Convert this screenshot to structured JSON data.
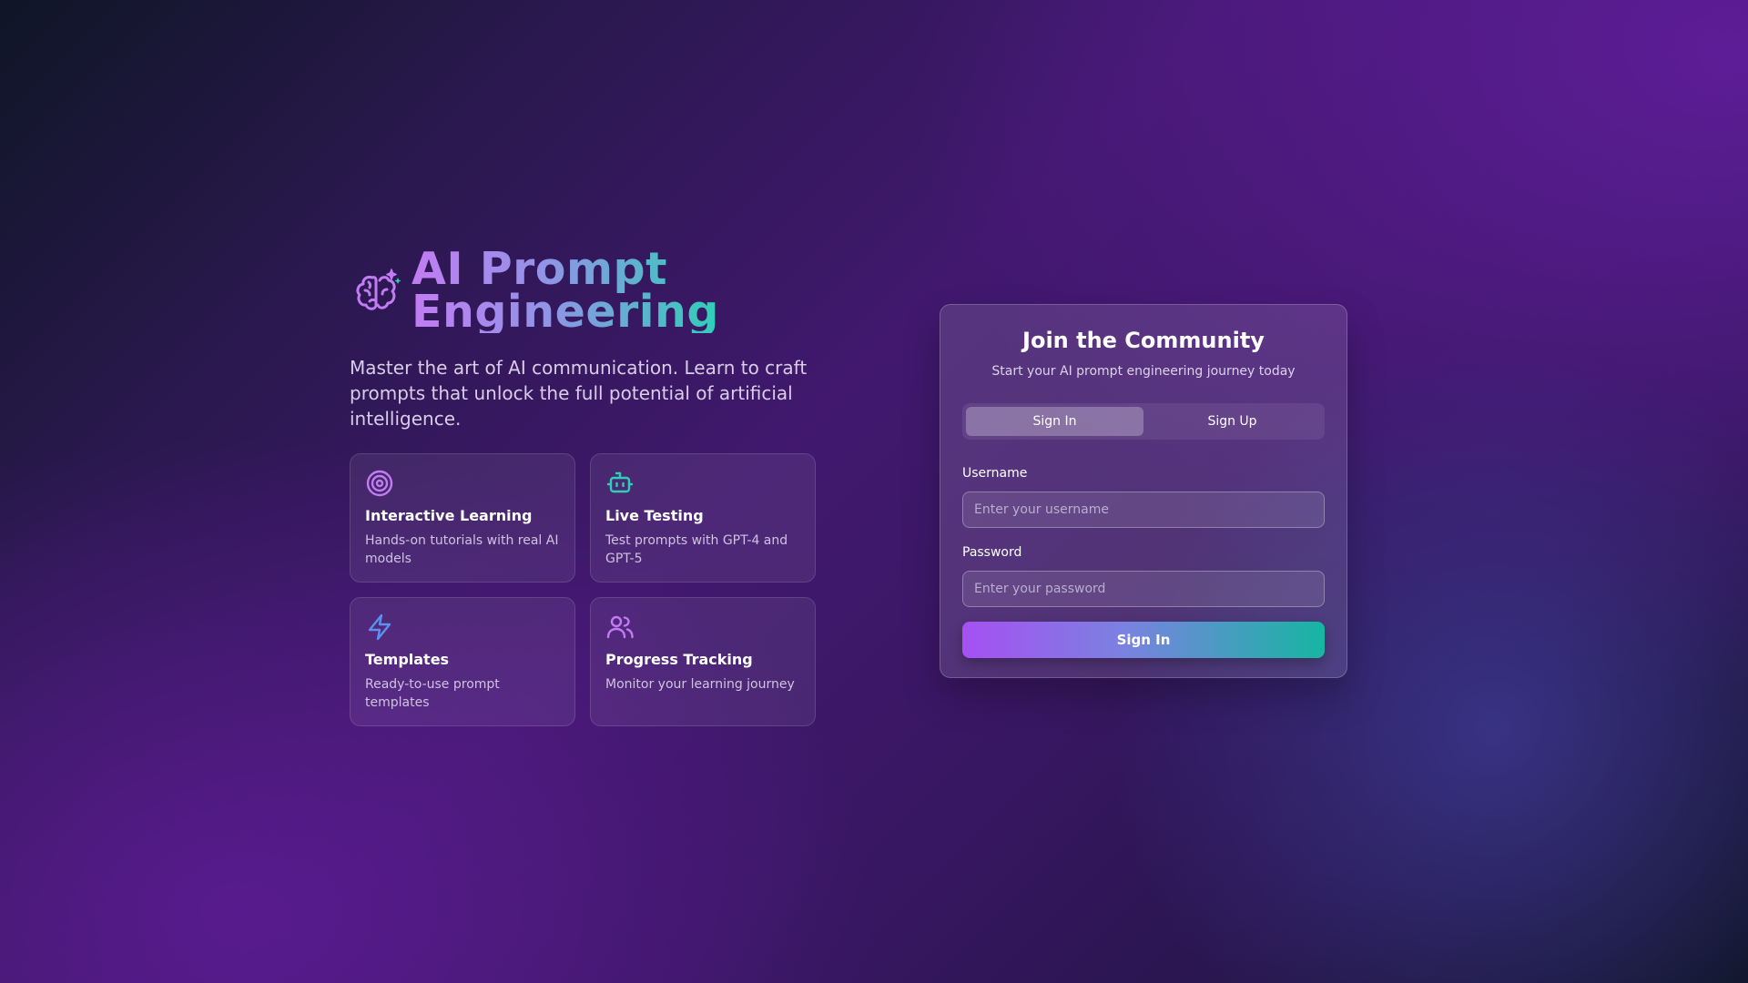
{
  "hero": {
    "title_line1": "AI Prompt",
    "title_line2": "Engineering",
    "subtitle": "Master the art of AI communication. Learn to craft prompts that unlock the full potential of artificial intelligence.",
    "logo_icon": "brain-sparkle-icon"
  },
  "features": [
    {
      "icon": "target-icon",
      "title": "Interactive Learning",
      "desc": "Hands-on tutorials with real AI models",
      "color": "#c27cf3"
    },
    {
      "icon": "bot-icon",
      "title": "Live Testing",
      "desc": "Test prompts with GPT-4 and GPT-5",
      "color": "#2fcfb7"
    },
    {
      "icon": "zap-icon",
      "title": "Templates",
      "desc": "Ready-to-use prompt templates",
      "color": "#5b8ff0"
    },
    {
      "icon": "users-icon",
      "title": "Progress Tracking",
      "desc": "Monitor your learning journey",
      "color": "#c27cf3"
    }
  ],
  "auth": {
    "title": "Join the Community",
    "subtitle": "Start your AI prompt engineering journey today",
    "tabs": {
      "sign_in": "Sign In",
      "sign_up": "Sign Up",
      "active": "sign_in"
    },
    "username": {
      "label": "Username",
      "placeholder": "Enter your username",
      "value": ""
    },
    "password": {
      "label": "Password",
      "placeholder": "Enter your password",
      "value": ""
    },
    "submit_label": "Sign In"
  },
  "colors": {
    "accent_purple": "#a650f3",
    "accent_teal": "#16b6a2",
    "accent_blue": "#5b8ff0"
  }
}
